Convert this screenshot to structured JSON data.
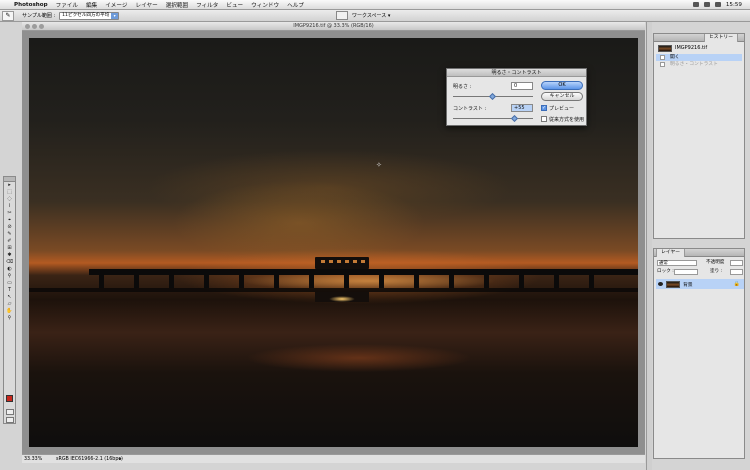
{
  "menubar": {
    "apple_glyph": "",
    "app_name": "Photoshop",
    "items": [
      "ファイル",
      "編集",
      "イメージ",
      "レイヤー",
      "選択範囲",
      "フィルタ",
      "ビュー",
      "ウィンドウ",
      "ヘルプ"
    ],
    "clock": "15:59"
  },
  "options": {
    "tool_glyph": "✎",
    "sample_label": "サンプル範囲 :",
    "sample_value": "11ピクセル四方の平均",
    "workspace_label": "ワークスペース ▾"
  },
  "document": {
    "title": "IMGP9216.tif @ 33.3% (RGB/16)",
    "crosshair_glyph": "✧"
  },
  "dialog": {
    "title": "明るさ・コントラスト",
    "brightness_label": "明るさ :",
    "brightness_value": "0",
    "contrast_label": "コントラスト :",
    "contrast_value": "+55",
    "ok_label": "OK",
    "cancel_label": "キャンセル",
    "preview_label": "プレビュー",
    "preview_checked": true,
    "legacy_label": "従来方式を使用",
    "legacy_checked": false,
    "checkmark": "✓",
    "brightness_level": 0.5,
    "contrast_level": 0.77
  },
  "status": {
    "zoom": "33.33%",
    "profile": "sRGB IEC61966-2.1 (16bpc)",
    "arrow": "▸"
  },
  "history": {
    "tab_label": "ヒストリー",
    "snapshot_name": "IMGP9216.tif",
    "items": [
      {
        "label": "開く",
        "active": true
      },
      {
        "label": "明るさ・コントラスト",
        "active": false
      }
    ]
  },
  "layers": {
    "tab_label": "レイヤー",
    "blend_mode": "通常",
    "opacity_label": "不透明度",
    "lock_label": "ロック :",
    "fill_label": "塗り :",
    "layer_name": "背景",
    "lock_glyph": "🔒"
  },
  "tools": [
    "▸",
    "⬚",
    "◌",
    "⌇",
    "✂",
    "⌖",
    "⊘",
    "✎",
    "✐",
    "⊞",
    "✱",
    "⌫",
    "◐",
    "⚲",
    "▭",
    "T",
    "↖",
    "▱",
    "✋",
    "⚲"
  ]
}
